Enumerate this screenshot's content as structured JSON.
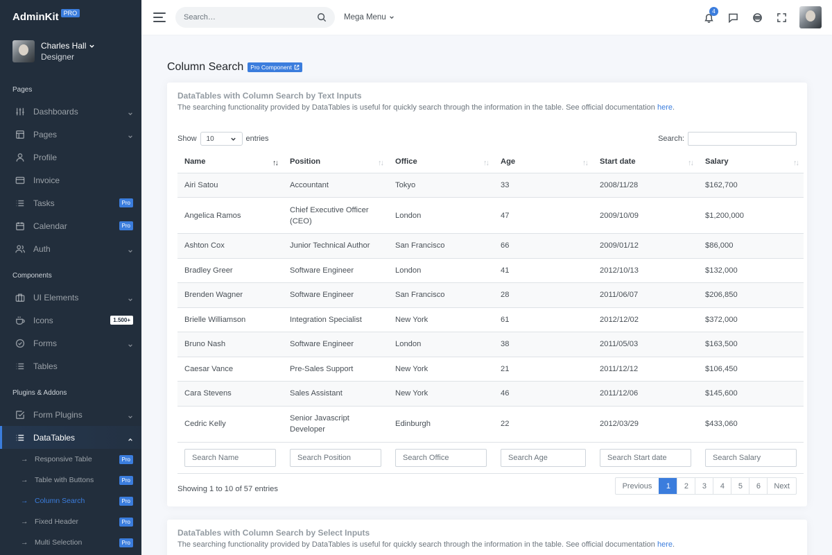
{
  "brand": {
    "name": "AdminKit",
    "badge": "PRO"
  },
  "user": {
    "name": "Charles Hall",
    "role": "Designer"
  },
  "sidebar": {
    "sections": {
      "pages": "Pages",
      "components": "Components",
      "plugins": "Plugins & Addons"
    },
    "pages": [
      {
        "label": "Dashboards",
        "icon": "sliders-icon"
      },
      {
        "label": "Pages",
        "icon": "layout-icon"
      },
      {
        "label": "Profile",
        "icon": "user-icon"
      },
      {
        "label": "Invoice",
        "icon": "credit-card-icon"
      },
      {
        "label": "Tasks",
        "icon": "list-icon",
        "badge": "Pro"
      },
      {
        "label": "Calendar",
        "icon": "calendar-icon",
        "badge": "Pro"
      },
      {
        "label": "Auth",
        "icon": "users-icon"
      }
    ],
    "components": [
      {
        "label": "UI Elements",
        "icon": "briefcase-icon"
      },
      {
        "label": "Icons",
        "icon": "coffee-icon",
        "badge": "1.500+"
      },
      {
        "label": "Forms",
        "icon": "check-circle-icon"
      },
      {
        "label": "Tables",
        "icon": "list-icon"
      }
    ],
    "plugins": [
      {
        "label": "Form Plugins",
        "icon": "check-square-icon"
      },
      {
        "label": "DataTables",
        "icon": "list-icon"
      }
    ],
    "datatables_sub": [
      {
        "label": "Responsive Table",
        "badge": "Pro"
      },
      {
        "label": "Table with Buttons",
        "badge": "Pro"
      },
      {
        "label": "Column Search",
        "badge": "Pro"
      },
      {
        "label": "Fixed Header",
        "badge": "Pro"
      },
      {
        "label": "Multi Selection",
        "badge": "Pro"
      }
    ]
  },
  "topbar": {
    "search_placeholder": "Search…",
    "mega_menu": "Mega Menu",
    "notifications_count": "4"
  },
  "page": {
    "title": "Column Search",
    "badge": "Pro Component"
  },
  "card1": {
    "title": "DataTables with Column Search by Text Inputs",
    "subtitle": "The searching functionality provided by DataTables is useful for quickly search through the information in the table. See official documentation",
    "link": "here",
    "show_label": "Show",
    "entries_value": "10",
    "entries_label": "entries",
    "search_label": "Search:",
    "columns": [
      "Name",
      "Position",
      "Office",
      "Age",
      "Start date",
      "Salary"
    ],
    "rows": [
      [
        "Airi Satou",
        "Accountant",
        "Tokyo",
        "33",
        "2008/11/28",
        "$162,700"
      ],
      [
        "Angelica Ramos",
        "Chief Executive Officer (CEO)",
        "London",
        "47",
        "2009/10/09",
        "$1,200,000"
      ],
      [
        "Ashton Cox",
        "Junior Technical Author",
        "San Francisco",
        "66",
        "2009/01/12",
        "$86,000"
      ],
      [
        "Bradley Greer",
        "Software Engineer",
        "London",
        "41",
        "2012/10/13",
        "$132,000"
      ],
      [
        "Brenden Wagner",
        "Software Engineer",
        "San Francisco",
        "28",
        "2011/06/07",
        "$206,850"
      ],
      [
        "Brielle Williamson",
        "Integration Specialist",
        "New York",
        "61",
        "2012/12/02",
        "$372,000"
      ],
      [
        "Bruno Nash",
        "Software Engineer",
        "London",
        "38",
        "2011/05/03",
        "$163,500"
      ],
      [
        "Caesar Vance",
        "Pre-Sales Support",
        "New York",
        "21",
        "2011/12/12",
        "$106,450"
      ],
      [
        "Cara Stevens",
        "Sales Assistant",
        "New York",
        "46",
        "2011/12/06",
        "$145,600"
      ],
      [
        "Cedric Kelly",
        "Senior Javascript Developer",
        "Edinburgh",
        "22",
        "2012/03/29",
        "$433,060"
      ]
    ],
    "column_search_placeholders": [
      "Search Name",
      "Search Position",
      "Search Office",
      "Search Age",
      "Search Start date",
      "Search Salary"
    ],
    "info": "Showing 1 to 10 of 57 entries",
    "pagination": {
      "previous": "Previous",
      "pages": [
        "1",
        "2",
        "3",
        "4",
        "5",
        "6"
      ],
      "next": "Next",
      "current": "1"
    }
  },
  "card2": {
    "title": "DataTables with Column Search by Select Inputs",
    "subtitle": "The searching functionality provided by DataTables is useful for quickly search through the information in the table. See official documentation",
    "link": "here"
  },
  "colors": {
    "sidebar_bg": "#222e3c",
    "accent": "#3b7ddd",
    "body_bg": "#f5f7fb"
  }
}
